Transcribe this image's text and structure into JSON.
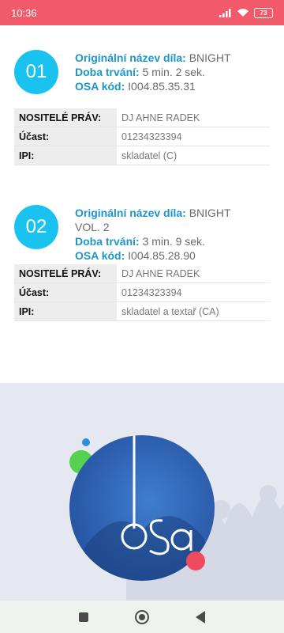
{
  "status_bar": {
    "time": "10:36",
    "battery": "73"
  },
  "works": [
    {
      "number": "01",
      "title_label": "Originální název díla:",
      "title_value": "BNIGHT",
      "duration_label": "Doba trvání:",
      "duration_value": "5 min. 2 sek.",
      "osa_label": "OSA kód:",
      "osa_value": "I004.85.35.31",
      "rights": [
        {
          "key": "NOSITELÉ PRÁV:",
          "value": "DJ AHNE RADEK"
        },
        {
          "key": "Účast:",
          "value": "01234323394"
        },
        {
          "key": "IPI:",
          "value": "skladatel (C)"
        }
      ]
    },
    {
      "number": "02",
      "title_label": "Originální název díla:",
      "title_value": "BNIGHT VOL. 2",
      "duration_label": "Doba trvání:",
      "duration_value": "3 min. 9 sek.",
      "osa_label": "OSA kód:",
      "osa_value": "I004.85.28.90",
      "rights": [
        {
          "key": "NOSITELÉ PRÁV:",
          "value": "DJ AHNE RADEK"
        },
        {
          "key": "Účast:",
          "value": "01234323394"
        },
        {
          "key": "IPI:",
          "value": "skladatel a textař (CA)"
        }
      ]
    }
  ],
  "colors": {
    "status_bar": "#f25a6b",
    "number_circle": "#19c2ef",
    "label_blue": "#1d95c9",
    "logo_blue": "#2d5fae"
  },
  "icons": {
    "status": [
      "signal-icon",
      "wifi-icon",
      "battery-icon"
    ],
    "nav": [
      "recent-apps-icon",
      "home-icon",
      "back-icon"
    ]
  },
  "logo_alt": "osa"
}
